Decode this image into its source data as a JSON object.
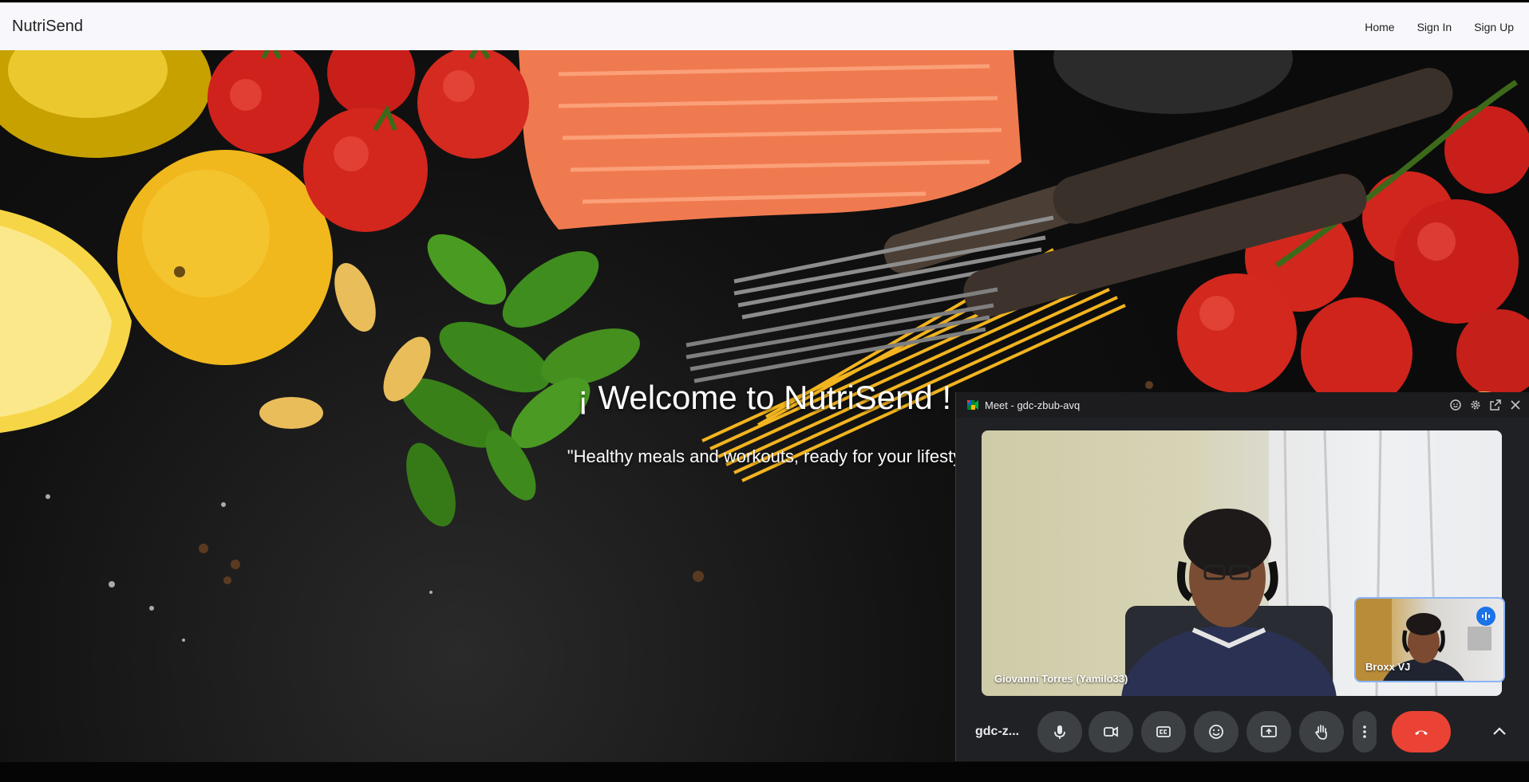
{
  "navbar": {
    "brand": "NutriSend",
    "links": [
      "Home",
      "Sign In",
      "Sign Up"
    ]
  },
  "hero": {
    "title": "¡ Welcome to NutriSend !",
    "subtitle": "\"Healthy meals and workouts, ready for your lifesty"
  },
  "meet": {
    "window_title": "Meet - gdc-zbub-avq",
    "title_icons": [
      "emoji-icon",
      "settings-icon",
      "pop-out-icon",
      "close-icon"
    ],
    "main_participant": "Giovanni Torres (Yamilo33)",
    "pip_participant": "Broxx VJ",
    "meeting_code_short": "gdc-z...",
    "controls": [
      "microphone",
      "camera",
      "captions",
      "reactions",
      "present-screen",
      "raise-hand",
      "more-options",
      "leave-call",
      "expand"
    ],
    "colors": {
      "hangup": "#ea4335",
      "speaking": "#1a73e8",
      "control_bg": "#3c4043",
      "panel_bg": "#202124"
    }
  }
}
